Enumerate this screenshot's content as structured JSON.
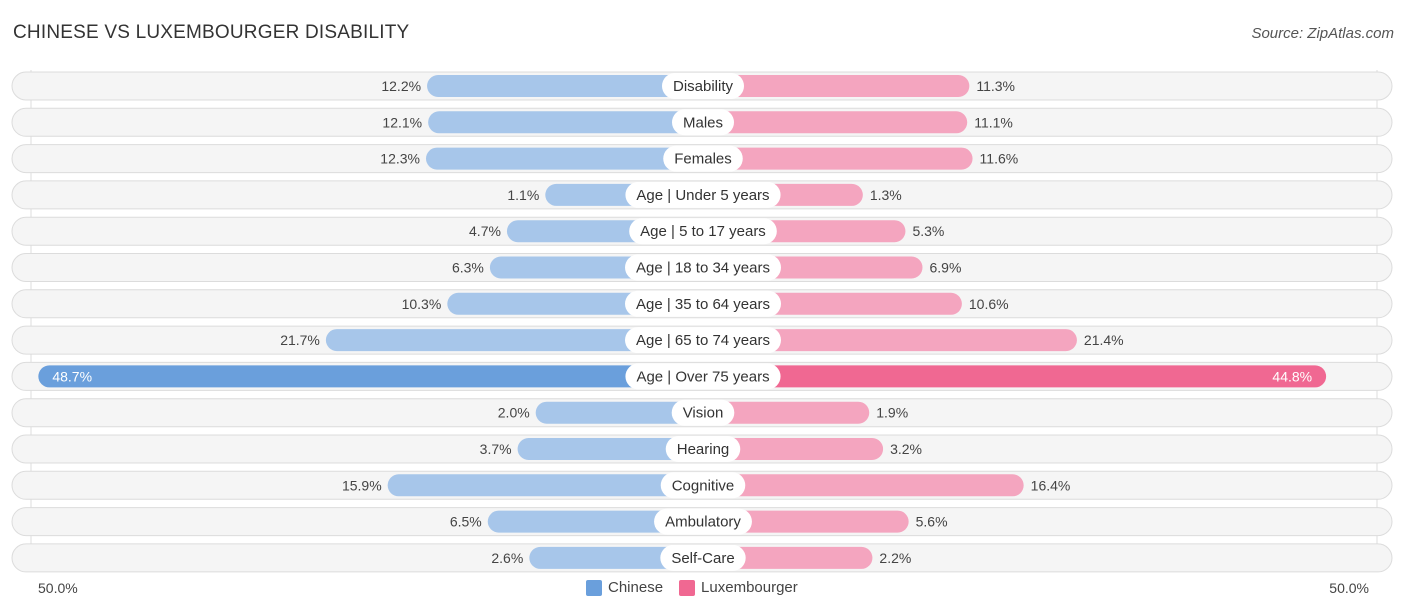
{
  "title": "CHINESE VS LUXEMBOURGER DISABILITY",
  "source": "Source: ZipAtlas.com",
  "colors": {
    "chinese": "#6a9fdc",
    "chinese_light": "#a7c6ea",
    "luxembourger": "#f06892",
    "luxembourger_light": "#f4a5bf"
  },
  "axis": {
    "left_label": "50.0%",
    "right_label": "50.0%"
  },
  "legend": [
    {
      "label": "Chinese",
      "color": "#6a9fdc"
    },
    {
      "label": "Luxembourger",
      "color": "#f06892"
    }
  ],
  "chart_data": {
    "type": "bar",
    "orientation": "horizontal-diverging",
    "title": "CHINESE VS LUXEMBOURGER DISABILITY",
    "xlim": [
      -50,
      50
    ],
    "categories": [
      "Disability",
      "Males",
      "Females",
      "Age | Under 5 years",
      "Age | 5 to 17 years",
      "Age | 18 to 34 years",
      "Age | 35 to 64 years",
      "Age | 65 to 74 years",
      "Age | Over 75 years",
      "Vision",
      "Hearing",
      "Cognitive",
      "Ambulatory",
      "Self-Care"
    ],
    "series": [
      {
        "name": "Chinese",
        "values": [
          12.2,
          12.1,
          12.3,
          1.1,
          4.7,
          6.3,
          10.3,
          21.7,
          48.7,
          2.0,
          3.7,
          15.9,
          6.5,
          2.6
        ]
      },
      {
        "name": "Luxembourger",
        "values": [
          11.3,
          11.1,
          11.6,
          1.3,
          5.3,
          6.9,
          10.6,
          21.4,
          44.8,
          1.9,
          3.2,
          16.4,
          5.6,
          2.2
        ]
      }
    ],
    "legend_position": "bottom-center"
  }
}
